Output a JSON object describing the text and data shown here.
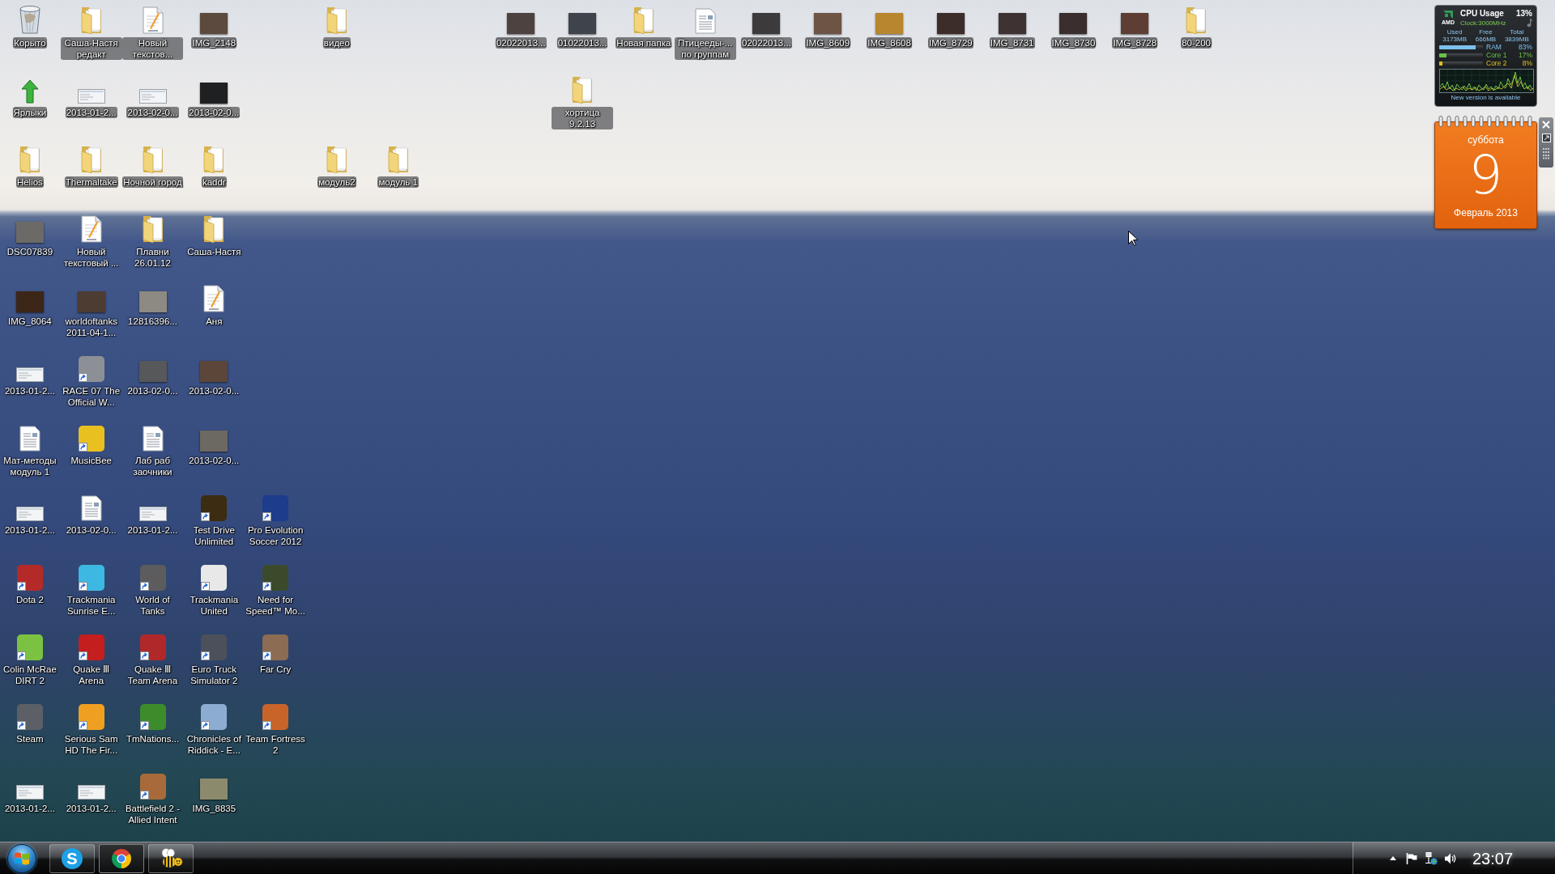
{
  "desktop": {
    "icons": [
      {
        "label": "Корыто",
        "kind": "recycle-bin",
        "shortcut": false
      },
      {
        "label": "Саша-Настя редакт",
        "kind": "folder",
        "shortcut": false
      },
      {
        "label": "Новый текстов...",
        "kind": "text-file",
        "shortcut": false
      },
      {
        "label": "IMG_2148",
        "kind": "photo",
        "shortcut": false,
        "color": "#5c4a3e"
      },
      {
        "label": "видео",
        "kind": "folder",
        "shortcut": false
      },
      {
        "label": "02022013...",
        "kind": "photo",
        "shortcut": false,
        "color": "#4e4240"
      },
      {
        "label": "01022013...",
        "kind": "photo",
        "shortcut": false,
        "color": "#3e434c"
      },
      {
        "label": "Новая папка",
        "kind": "folder",
        "shortcut": false
      },
      {
        "label": "Птицееды-... по группам",
        "kind": "document",
        "shortcut": false
      },
      {
        "label": "02022013...",
        "kind": "photo",
        "shortcut": false,
        "color": "#3c3a3a"
      },
      {
        "label": "IMG_8609",
        "kind": "photo",
        "shortcut": false,
        "color": "#6e5444"
      },
      {
        "label": "IMG_8608",
        "kind": "photo",
        "shortcut": false,
        "color": "#b8862e"
      },
      {
        "label": "IMG_8729",
        "kind": "photo",
        "shortcut": false,
        "color": "#3c2c2a"
      },
      {
        "label": "IMG_8731",
        "kind": "photo",
        "shortcut": false,
        "color": "#3e3232"
      },
      {
        "label": "IMG_8730",
        "kind": "photo",
        "shortcut": false,
        "color": "#3a2e2e"
      },
      {
        "label": "IMG_8728",
        "kind": "photo",
        "shortcut": false,
        "color": "#5e3e34"
      },
      {
        "label": "80-200",
        "kind": "folder",
        "shortcut": false
      },
      {
        "label": "Ярлыки",
        "kind": "arrow",
        "shortcut": false
      },
      {
        "label": "2013-01-2...",
        "kind": "screenshot",
        "shortcut": false
      },
      {
        "label": "2013-02-0...",
        "kind": "screenshot",
        "shortcut": false
      },
      {
        "label": "2013-02-0...",
        "kind": "photo",
        "shortcut": false,
        "color": "#1e2022"
      },
      {
        "label": "хортица 9.2.13",
        "kind": "folder",
        "shortcut": false
      },
      {
        "label": "Helios",
        "kind": "folder",
        "shortcut": false
      },
      {
        "label": "Thermaltake",
        "kind": "folder",
        "shortcut": false
      },
      {
        "label": "Ночной город",
        "kind": "folder",
        "shortcut": false
      },
      {
        "label": "kaddr",
        "kind": "folder",
        "shortcut": false
      },
      {
        "label": "модуль2",
        "kind": "folder",
        "shortcut": false
      },
      {
        "label": "модуль 1",
        "kind": "folder",
        "shortcut": false
      },
      {
        "label": "DSC07839",
        "kind": "photo",
        "shortcut": false,
        "color": "#6c6a66"
      },
      {
        "label": "Новый текстовый ...",
        "kind": "text-file",
        "shortcut": false
      },
      {
        "label": "Плавни 26.01.12",
        "kind": "folder",
        "shortcut": false
      },
      {
        "label": "Саша-Настя",
        "kind": "folder",
        "shortcut": false
      },
      {
        "label": "IMG_8064",
        "kind": "photo",
        "shortcut": false,
        "color": "#3c2618"
      },
      {
        "label": "worldoftanks 2011-04-1...",
        "kind": "photo",
        "shortcut": false,
        "color": "#4c3c32"
      },
      {
        "label": "12816396...",
        "kind": "photo",
        "shortcut": false,
        "color": "#8c8a82"
      },
      {
        "label": "Аня",
        "kind": "text-file",
        "shortcut": false
      },
      {
        "label": "2013-01-2...",
        "kind": "screenshot",
        "shortcut": false
      },
      {
        "label": "RACE 07 The Official W...",
        "kind": "app",
        "shortcut": true,
        "color": "#8c9096"
      },
      {
        "label": "2013-02-0...",
        "kind": "photo",
        "shortcut": false,
        "color": "#56585a"
      },
      {
        "label": "2013-02-0...",
        "kind": "photo",
        "shortcut": false,
        "color": "#5c463a"
      },
      {
        "label": "Мат-методы модуль 1",
        "kind": "document",
        "shortcut": false
      },
      {
        "label": "MusicBee",
        "kind": "app",
        "shortcut": true,
        "color": "#e8c020"
      },
      {
        "label": "Лаб раб заочники",
        "kind": "document",
        "shortcut": false
      },
      {
        "label": "2013-02-0...",
        "kind": "photo",
        "shortcut": false,
        "color": "#6c6862"
      },
      {
        "label": "2013-01-2...",
        "kind": "screenshot",
        "shortcut": false
      },
      {
        "label": "2013-02-0...",
        "kind": "document",
        "shortcut": false
      },
      {
        "label": "2013-01-2...",
        "kind": "screenshot",
        "shortcut": false
      },
      {
        "label": "Test Drive Unlimited",
        "kind": "app",
        "shortcut": true,
        "color": "#3c2c12"
      },
      {
        "label": "Pro Evolution Soccer 2012",
        "kind": "app",
        "shortcut": true,
        "color": "#1c3c8c"
      },
      {
        "label": "Dota 2",
        "kind": "app",
        "shortcut": true,
        "color": "#b42a28"
      },
      {
        "label": "Trackmania Sunrise E...",
        "kind": "app",
        "shortcut": true,
        "color": "#3cb8e2"
      },
      {
        "label": "World of Tanks",
        "kind": "app",
        "shortcut": true,
        "color": "#5c5c5e"
      },
      {
        "label": "Trackmania United",
        "kind": "app",
        "shortcut": true,
        "color": "#e8e8e8"
      },
      {
        "label": "Need for Speed™ Mo...",
        "kind": "app",
        "shortcut": true,
        "color": "#3c4a2c"
      },
      {
        "label": "Colin McRae DIRT 2",
        "kind": "app",
        "shortcut": true,
        "color": "#7cc242"
      },
      {
        "label": "Quake Ⅲ Arena",
        "kind": "app",
        "shortcut": true,
        "color": "#c41e1e"
      },
      {
        "label": "Quake Ⅲ Team Arena",
        "kind": "app",
        "shortcut": true,
        "color": "#b0282a"
      },
      {
        "label": "Euro Truck Simulator 2",
        "kind": "app",
        "shortcut": true,
        "color": "#4c505a"
      },
      {
        "label": "Far Cry",
        "kind": "app",
        "shortcut": true,
        "color": "#8c6c52"
      },
      {
        "label": "Steam",
        "kind": "app",
        "shortcut": true,
        "color": "#5c6066"
      },
      {
        "label": "Serious Sam HD The Fir...",
        "kind": "app",
        "shortcut": true,
        "color": "#f0a020"
      },
      {
        "label": "TmNations...",
        "kind": "app",
        "shortcut": true,
        "color": "#3c8c2c"
      },
      {
        "label": "Chronicles of Riddick - E...",
        "kind": "app",
        "shortcut": true,
        "color": "#8cacd2"
      },
      {
        "label": "Team Fortress 2",
        "kind": "app",
        "shortcut": true,
        "color": "#c8642a"
      },
      {
        "label": "2013-01-2...",
        "kind": "screenshot",
        "shortcut": false
      },
      {
        "label": "2013-01-2...",
        "kind": "screenshot",
        "shortcut": false
      },
      {
        "label": "Battlefield 2 - Allied Intent",
        "kind": "app",
        "shortcut": true,
        "color": "#a86a3a"
      },
      {
        "label": "IMG_8835",
        "kind": "photo",
        "shortcut": false,
        "color": "#8c8a6c"
      }
    ]
  },
  "gadgets": {
    "cpu_meter": {
      "logo": "AMD",
      "title": "CPU Usage",
      "usage": "13%",
      "clock": "Clock:3000MHz",
      "memory": [
        {
          "header": "Used",
          "value": "3173MB"
        },
        {
          "header": "Free",
          "value": "666MB"
        },
        {
          "header": "Total",
          "value": "3839MB"
        }
      ],
      "meters": [
        {
          "label": "RAM",
          "reading": "83%",
          "level": 0.83,
          "color": "#7cc0ec"
        },
        {
          "label": "Core 1",
          "reading": "17%",
          "level": 0.17,
          "color": "#6cc04a"
        },
        {
          "label": "Core 2",
          "reading": "8%",
          "level": 0.08,
          "color": "#e0c020"
        }
      ],
      "notice": "New version is available"
    },
    "calendar": {
      "weekday": "суббота",
      "day": "9",
      "month_year": "Февраль 2013"
    }
  },
  "taskbar": {
    "apps": [
      {
        "kind": "chat",
        "logo_text": "S",
        "selected": false
      },
      {
        "kind": "browser",
        "selected": true
      },
      {
        "kind": "player",
        "selected": false
      }
    ],
    "clock": "23:07"
  }
}
